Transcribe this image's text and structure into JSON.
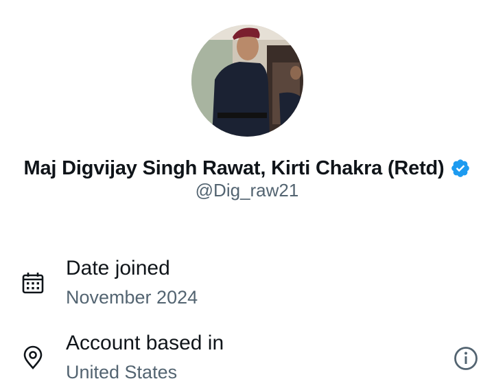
{
  "profile": {
    "avatar_alt": "Profile photo",
    "display_name": "Maj Digvijay Singh Rawat, Kirti Chakra (Retd)",
    "handle": "@Dig_raw21",
    "verified": true,
    "verified_color": "#1d9bf0"
  },
  "details": {
    "date_joined": {
      "icon": "calendar-icon",
      "label": "Date joined",
      "value": "November 2024"
    },
    "account_based_in": {
      "icon": "location-pin-icon",
      "label": "Account based in",
      "value": "United States",
      "info_icon": "info-icon"
    }
  },
  "colors": {
    "primary_text": "#0f1419",
    "secondary_text": "#536471",
    "accent": "#1d9bf0"
  }
}
